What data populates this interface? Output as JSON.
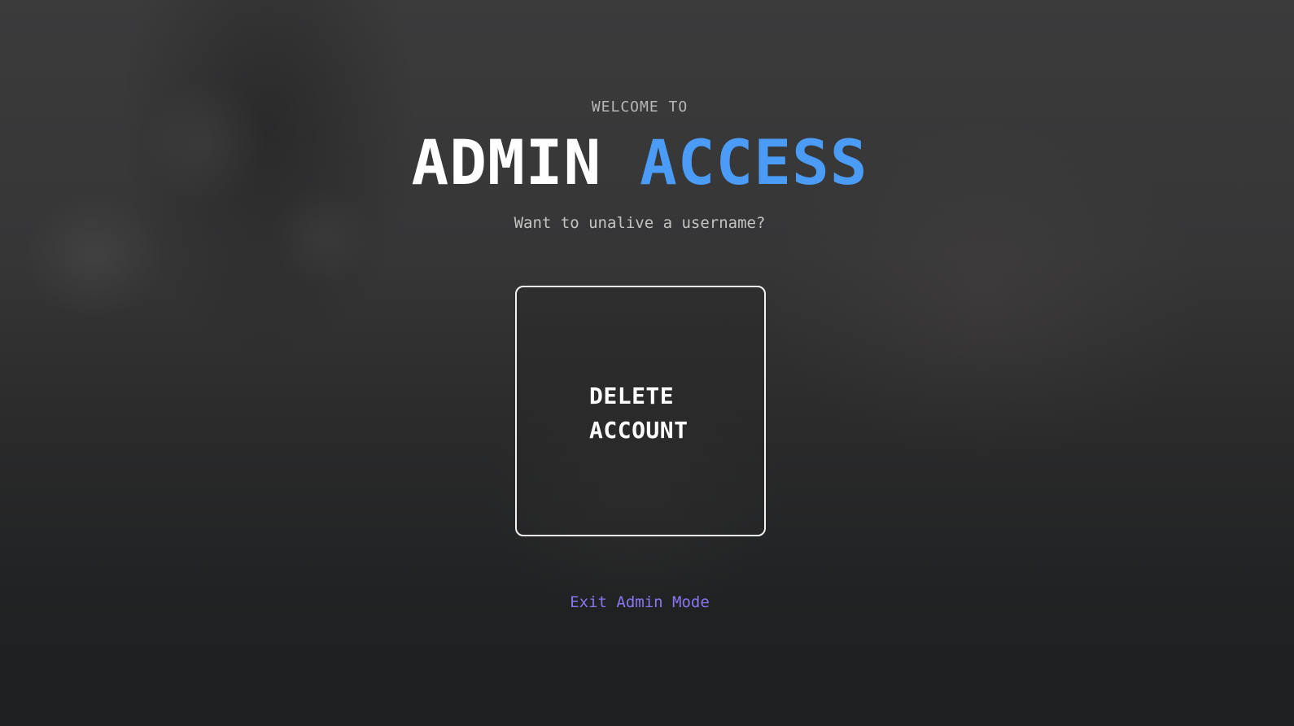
{
  "header": {
    "welcome": "WELCOME TO",
    "title_main": "ADMIN",
    "title_accent": "ACCESS",
    "subtitle": "Want to unalive a username?"
  },
  "actions": {
    "delete_line1": "DELETE",
    "delete_line2": "ACCOUNT"
  },
  "footer": {
    "exit_label": "Exit Admin Mode"
  },
  "colors": {
    "accent": "#4a9cf6",
    "link": "#8a76f0",
    "text": "#ffffff",
    "muted": "#b7b7b7"
  }
}
